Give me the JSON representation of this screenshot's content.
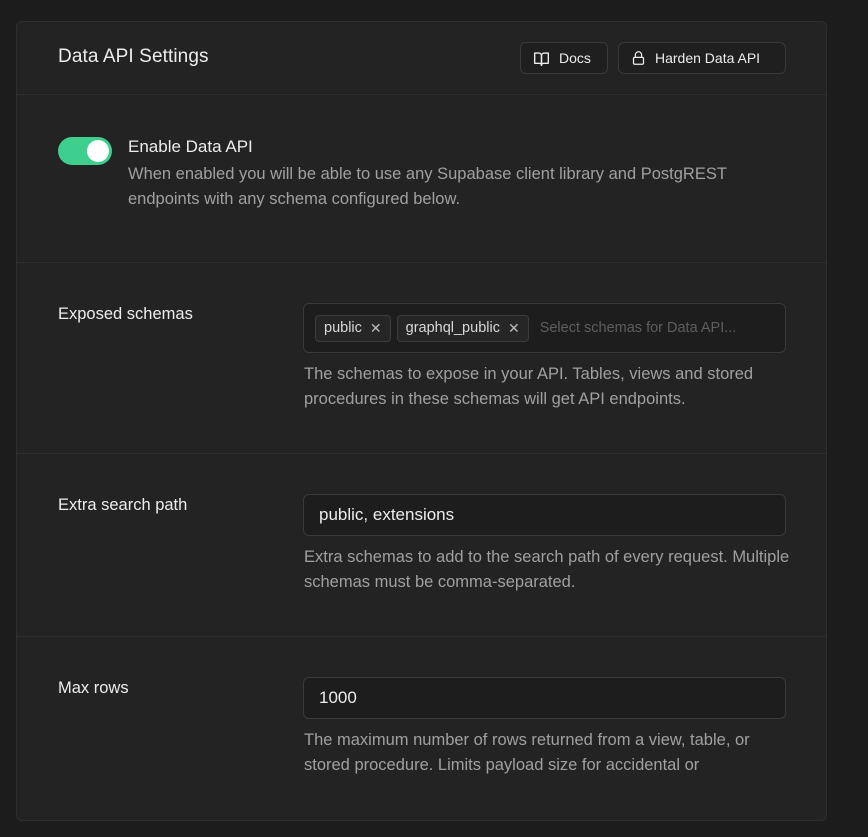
{
  "header": {
    "title": "Data API Settings",
    "docs_label": "Docs",
    "harden_label": "Harden Data API"
  },
  "enable": {
    "label": "Enable Data API",
    "description": "When enabled you will be able to use any Supabase client library and PostgREST endpoints with any schema configured below.",
    "enabled": true,
    "color": "#3ecf8e"
  },
  "schemas": {
    "label": "Exposed schemas",
    "chips": [
      "public",
      "graphql_public"
    ],
    "placeholder": "Select schemas for Data API...",
    "description": "The schemas to expose in your API. Tables, views and stored procedures in these schemas will get API endpoints."
  },
  "search_path": {
    "label": "Extra search path",
    "value": "public, extensions",
    "description": "Extra schemas to add to the search path of every request. Multiple schemas must be comma-separated."
  },
  "max_rows": {
    "label": "Max rows",
    "value": "1000",
    "description": "The maximum number of rows returned from a view, table, or stored procedure. Limits payload size for accidental or"
  },
  "icons": {
    "docs": "book-open-icon",
    "harden": "lock-icon",
    "chip_remove": "close-icon"
  }
}
